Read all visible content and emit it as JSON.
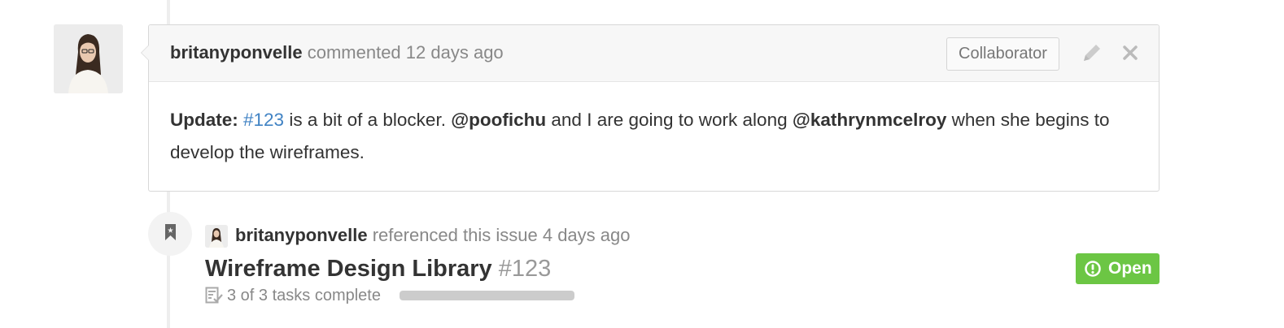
{
  "comment": {
    "author": "britanyponvelle",
    "action": "commented",
    "time": "12 days ago",
    "role_badge": "Collaborator",
    "body": {
      "prefix": "Update:",
      "issue_ref": "#123",
      "text_1": "is a bit of a blocker.",
      "mention_1": "@poofichu",
      "text_2": "and I are going to work along",
      "mention_2": "@kathrynmcelroy",
      "text_3": "when she begins to develop the wireframes."
    }
  },
  "reference_event": {
    "author": "britanyponvelle",
    "action": "referenced this issue",
    "time": "4 days ago",
    "issue_title": "Wireframe Design Library",
    "issue_number": "#123",
    "state_label": "Open",
    "tasks_text": "3 of 3 tasks complete",
    "tasks_progress": 1.0
  },
  "icons": {
    "edit": "pencil-icon",
    "close": "close-icon",
    "event": "bookmark-icon",
    "state": "issue-opened-icon",
    "tasks": "task-list-icon"
  },
  "colors": {
    "link": "#4183c4",
    "open_badge": "#6cc644",
    "progress_fill": "#cccccc"
  }
}
